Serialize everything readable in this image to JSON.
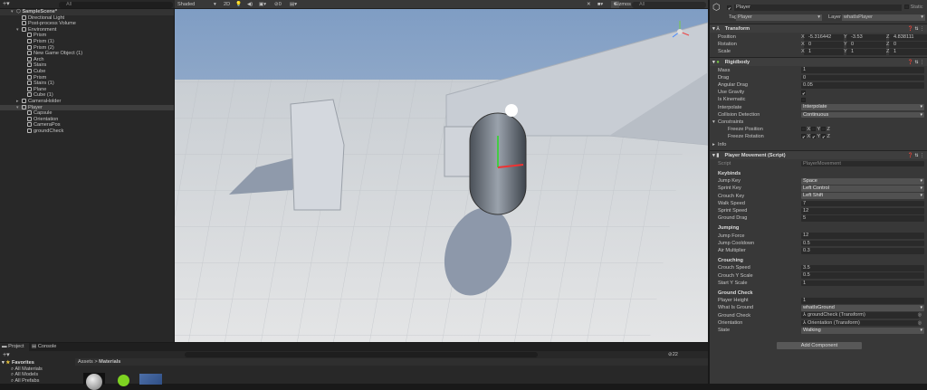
{
  "hierarchy": {
    "search_placeholder": "All",
    "items": [
      {
        "label": "SampleScene*",
        "depth": 0,
        "arrow": "▾",
        "kind": "scene"
      },
      {
        "label": "Directional Light",
        "depth": 1
      },
      {
        "label": "Post-process Volume",
        "depth": 1
      },
      {
        "label": "Environment",
        "depth": 1,
        "arrow": "▾"
      },
      {
        "label": "Prism",
        "depth": 2
      },
      {
        "label": "Prism (1)",
        "depth": 2
      },
      {
        "label": "Prism (2)",
        "depth": 2
      },
      {
        "label": "New Game Object (1)",
        "depth": 2
      },
      {
        "label": "Arch",
        "depth": 2
      },
      {
        "label": "Stairs",
        "depth": 2
      },
      {
        "label": "Cube",
        "depth": 2
      },
      {
        "label": "Prism",
        "depth": 2
      },
      {
        "label": "Stairs (1)",
        "depth": 2
      },
      {
        "label": "Plane",
        "depth": 2
      },
      {
        "label": "Cube (1)",
        "depth": 2
      },
      {
        "label": "CameraHolder",
        "depth": 1,
        "arrow": "▸"
      },
      {
        "label": "Player",
        "depth": 1,
        "arrow": "▾",
        "kind": "sel"
      },
      {
        "label": "Capsule",
        "depth": 2
      },
      {
        "label": "Orientation",
        "depth": 2
      },
      {
        "label": "CameraPos",
        "depth": 2
      },
      {
        "label": "groundCheck",
        "depth": 2
      }
    ]
  },
  "scene": {
    "shading": "Shaded",
    "mode_2d": "2D",
    "hidden_count": "0",
    "gizmos": "Gizmos",
    "search_placeholder": "All"
  },
  "inspector": {
    "object_name": "Player",
    "static_label": "Static",
    "tag_label": "Tag",
    "tag": "Player",
    "layer_label": "Layer",
    "layer": "whatIsPlayer",
    "transform": {
      "title": "Transform",
      "rows": [
        {
          "label": "Position",
          "x": "-5.316442",
          "y": "-3.53",
          "z": "4.838111"
        },
        {
          "label": "Rotation",
          "x": "0",
          "y": "0",
          "z": "0"
        },
        {
          "label": "Scale",
          "x": "1",
          "y": "1",
          "z": "1"
        }
      ]
    },
    "rigidbody": {
      "title": "Rigidbody",
      "rows": [
        {
          "type": "field",
          "label": "Mass",
          "value": "1"
        },
        {
          "type": "field",
          "label": "Drag",
          "value": "0"
        },
        {
          "type": "field",
          "label": "Angular Drag",
          "value": "0.05"
        },
        {
          "type": "check",
          "label": "Use Gravity",
          "value": "✔"
        },
        {
          "type": "check",
          "label": "Is Kinematic",
          "value": ""
        },
        {
          "type": "dropdown",
          "label": "Interpolate",
          "value": "Interpolate"
        },
        {
          "type": "dropdown",
          "label": "Collision Detection",
          "value": "Continuous"
        },
        {
          "type": "fold",
          "label": "Constraints",
          "arrow": "▾"
        },
        {
          "type": "axes",
          "label": "Freeze Position",
          "checks": [
            "",
            "",
            ""
          ]
        },
        {
          "type": "axes",
          "label": "Freeze Rotation",
          "checks": [
            "✔",
            "✔",
            "✔"
          ]
        },
        {
          "type": "fold",
          "label": "Info",
          "arrow": "▸"
        }
      ]
    },
    "movement": {
      "title": "Player Movement (Script)",
      "rows": [
        {
          "type": "script",
          "label": "Script",
          "value": "PlayerMovement"
        },
        {
          "type": "section",
          "label": "Keybinds"
        },
        {
          "type": "dropdown",
          "label": "Jump Key",
          "value": "Space"
        },
        {
          "type": "dropdown",
          "label": "Sprint Key",
          "value": "Left Control"
        },
        {
          "type": "dropdown",
          "label": "Crouch Key",
          "value": "Left Shift"
        },
        {
          "type": "field",
          "label": "Walk Speed",
          "value": "7"
        },
        {
          "type": "field",
          "label": "Sprint Speed",
          "value": "12"
        },
        {
          "type": "field",
          "label": "Ground Drag",
          "value": "5"
        },
        {
          "type": "section",
          "label": "Jumping"
        },
        {
          "type": "field",
          "label": "Jump Force",
          "value": "12"
        },
        {
          "type": "field",
          "label": "Jump Cooldown",
          "value": "0.5"
        },
        {
          "type": "field",
          "label": "Air Multiplier",
          "value": "0.3"
        },
        {
          "type": "section",
          "label": "Crouching"
        },
        {
          "type": "field",
          "label": "Crouch Speed",
          "value": "3.5"
        },
        {
          "type": "field",
          "label": "Crouch Y Scale",
          "value": "0.5"
        },
        {
          "type": "field",
          "label": "Start Y Scale",
          "value": "1"
        },
        {
          "type": "section",
          "label": "Ground Check"
        },
        {
          "type": "field",
          "label": "Player Height",
          "value": "1"
        },
        {
          "type": "dropdown",
          "label": "What Is Ground",
          "value": "whatIsGround"
        },
        {
          "type": "object",
          "label": "Ground Check",
          "value": "⅄ groundCheck (Transform)"
        },
        {
          "type": "object",
          "label": "Orientation",
          "value": "⅄ Orientation (Transform)"
        },
        {
          "type": "dropdown",
          "label": "State",
          "value": "Walking"
        }
      ]
    },
    "add_component": "Add Component"
  },
  "project": {
    "tabs": [
      "Project",
      "Console"
    ],
    "favorites": "Favorites",
    "fav_items": [
      "All Materials",
      "All Models",
      "All Prefabs"
    ],
    "breadcrumb": [
      "Assets",
      "Materials"
    ],
    "hidden_count": "22"
  }
}
